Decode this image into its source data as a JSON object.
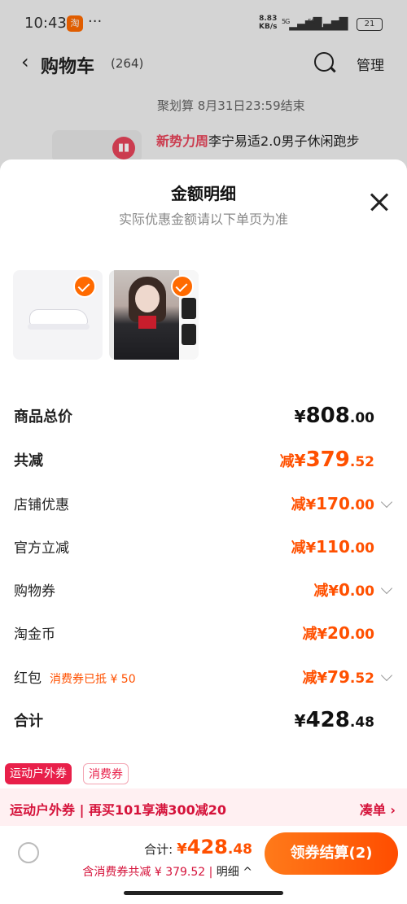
{
  "status_bar": {
    "time": "10:43",
    "app_badge": "淘",
    "more": "···",
    "net_speed": "8.83",
    "net_unit": "KB/s",
    "signal1": "5G",
    "signal2": "5G",
    "battery": "21"
  },
  "nav": {
    "title": "购物车",
    "count": "(264)",
    "manage": "管理"
  },
  "background": {
    "promo": "聚划算 8月31日23:59结束",
    "item_title_highlight": "新势力周",
    "item_title": "李宁易适2.0男子休闲跑步"
  },
  "sheet": {
    "title": "金额明细",
    "subtitle": "实际优惠金额请以下单页为准"
  },
  "rows": {
    "goods_total": {
      "label": "商品总价",
      "symbol": "¥",
      "int": "808",
      "dec": ".00"
    },
    "total_reduce": {
      "label": "共减",
      "prefix": "减",
      "symbol": "¥",
      "int": "379",
      "dec": ".52"
    },
    "store": {
      "label": "店铺优惠",
      "prefix": "减",
      "symbol": "¥",
      "int": "170",
      "dec": ".00"
    },
    "official": {
      "label": "官方立减",
      "prefix": "减",
      "symbol": "¥",
      "int": "110",
      "dec": ".00"
    },
    "voucher": {
      "label": "购物券",
      "prefix": "减",
      "symbol": "¥",
      "int": "0",
      "dec": ".00"
    },
    "coins": {
      "label": "淘金币",
      "prefix": "减",
      "symbol": "¥",
      "int": "20",
      "dec": ".00"
    },
    "redpack": {
      "label": "红包",
      "note": "消费券已抵 ¥ 50",
      "prefix": "减",
      "symbol": "¥",
      "int": "79",
      "dec": ".52"
    },
    "sum": {
      "label": "合计",
      "symbol": "¥",
      "int": "428",
      "dec": ".48"
    }
  },
  "tags": {
    "category": "运动户外券",
    "coupon": "消费券"
  },
  "strip": {
    "text": "运动户外券 | 再买101享满300减20",
    "action": "凑单 ›"
  },
  "bottom": {
    "total_label": "合计:",
    "symbol": "¥",
    "int": "428",
    "dec": ".48",
    "discount_text": "含消费券共减 ¥ 379.52 |",
    "detail": " 明细 ^",
    "checkout": "领券结算(2)"
  },
  "colors": {
    "accent": "#ff5000",
    "checkout_gradient_start": "#ff7a1a",
    "promo_red": "#e8204a"
  }
}
